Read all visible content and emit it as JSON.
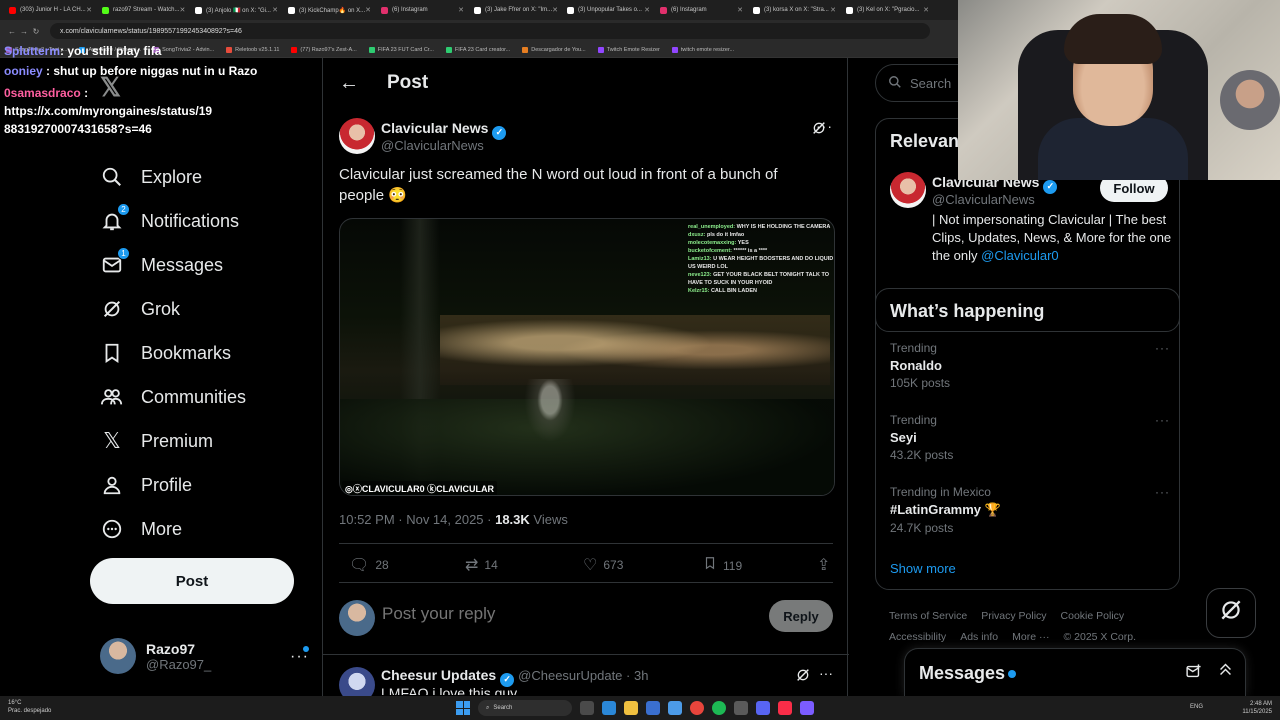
{
  "browser": {
    "tabs": [
      {
        "title": "(303) Junior H - LA CH...",
        "color": "#ff0000"
      },
      {
        "title": "razo97 Stream - Watch...",
        "color": "#53fc18"
      },
      {
        "title": "(3) Anjolo 🇮🇹 on X: \"Gi...",
        "color": "#ffffff"
      },
      {
        "title": "(3) KickChamp🔥 on X...",
        "color": "#ffffff"
      },
      {
        "title": "(6) Instagram",
        "color": "#e1306c"
      },
      {
        "title": "(3) Jake Ffrer on X: \"Im...",
        "color": "#ffffff"
      },
      {
        "title": "(3) Unpopular Takes o...",
        "color": "#ffffff"
      },
      {
        "title": "(6) Instagram",
        "color": "#e1306c"
      },
      {
        "title": "(3) korsa X on X: \"Stra...",
        "color": "#ffffff"
      },
      {
        "title": "(3) Kel on X: \"Pgracio...",
        "color": "#ffffff"
      }
    ],
    "url": "x.com/clavicularnews/status/1989557199245340892?s=46",
    "bookmarks": [
      {
        "label": "SongTrivia2 - Test y...",
        "color": "#9b59b6"
      },
      {
        "label": "App Store / Streami...",
        "color": "#1d9bf0"
      },
      {
        "label": "SongTrivia2 - Advin...",
        "color": "#9b59b6"
      },
      {
        "label": "Reletoob v25.1.11",
        "color": "#e74c3c"
      },
      {
        "label": "(77) Razo97's Zest-A...",
        "color": "#ff0000"
      },
      {
        "label": "FIFA 23 FUT Card Cr...",
        "color": "#2ecc71"
      },
      {
        "label": "FIFA 23 Card creator...",
        "color": "#2ecc71"
      },
      {
        "label": "Descargador de You...",
        "color": "#e67e22"
      },
      {
        "label": "Twitch Emote Resizer",
        "color": "#9146ff"
      },
      {
        "label": "twitch emote resizer...",
        "color": "#9146ff"
      }
    ]
  },
  "chat_overlay": {
    "top_line": "you still play fifa",
    "top_name": "Splutterm",
    "lines": [
      {
        "name": "ooniey",
        "message": ": shut up before niggas nut in u Razo"
      },
      {
        "name": "0samasdraco",
        "message": ":"
      },
      {
        "name": "",
        "message": "https://x.com/myrongaines/status/1988319270007431658?s=46"
      }
    ]
  },
  "nav": {
    "items": [
      {
        "label": "Explore"
      },
      {
        "label": "Notifications",
        "badge": "2"
      },
      {
        "label": "Messages",
        "badge": "1"
      },
      {
        "label": "Grok"
      },
      {
        "label": "Bookmarks"
      },
      {
        "label": "Communities"
      },
      {
        "label": "Premium"
      },
      {
        "label": "Profile"
      },
      {
        "label": "More"
      }
    ],
    "post_button": "Post"
  },
  "account": {
    "name": "Razo97",
    "handle": "@Razo97_"
  },
  "post": {
    "header_title": "Post",
    "author_name": "Clavicular News",
    "author_handle": "@ClavicularNews",
    "text": "Clavicular just screamed the N word out loud in front of a bunch of people 😳",
    "media_chat": [
      {
        "user": "real_unemployed:",
        "msg": "WHY IS HE HOLDING THE CAMERA"
      },
      {
        "user": "dxusz:",
        "msg": "pls do it lmfao"
      },
      {
        "user": "molecotemaxxing:",
        "msg": "YES"
      },
      {
        "user": "bucketofcement:",
        "msg": "****** is a ****"
      },
      {
        "user": "Lamiz13:",
        "msg": "U WEAR HEIGHT BOOSTERS AND DO LIQUID US WEIRD LOL"
      },
      {
        "user": "neve123:",
        "msg": "GET YOUR BLACK BELT TONIGHT TALK TO HAVE TO SUCK IN YOUR HYOID"
      },
      {
        "user": "Kelzr15:",
        "msg": "CALL BIN LADEN"
      }
    ],
    "media_watermark": "◎ⓧCLAVICULAR0 ⓚCLAVICULAR",
    "timestamp": "10:52 PM · Nov 14, 2025 · ",
    "views": "18.3K",
    "views_label": "Views",
    "replies": "28",
    "reposts": "14",
    "likes": "673",
    "bookmarks": "119",
    "reply_placeholder": "Post your reply",
    "reply_button": "Reply"
  },
  "reply_tweet": {
    "name": "Cheesur Updates",
    "handle": "@CheesurUpdate · 3h",
    "text": "LMFAO i love this guy"
  },
  "right": {
    "search_placeholder": "Search",
    "relevant_title": "Relevant people",
    "relevant_name": "Clavicular News",
    "relevant_handle": "@ClavicularNews",
    "follow_label": "Follow",
    "relevant_bio": "| Not impersonating Clavicular | The best Clips, Updates, News, & More for the one the only ",
    "relevant_bio_link": "@Clavicular0",
    "happening_title": "What’s happening",
    "trends": [
      {
        "meta": "Trending",
        "title": "Ronaldo",
        "count": "105K posts"
      },
      {
        "meta": "Trending",
        "title": "Seyi",
        "count": "43.2K posts"
      },
      {
        "meta": "Trending in Mexico",
        "title": "#LatinGrammy 🏆",
        "count": "24.7K posts"
      }
    ],
    "show_more": "Show more",
    "footer": [
      "Terms of Service",
      "Privacy Policy",
      "Cookie Policy",
      "Accessibility",
      "Ads info",
      "More ···",
      "© 2025 X Corp."
    ]
  },
  "messages_drawer": {
    "title": "Messages"
  },
  "taskbar": {
    "weather_temp": "16°C",
    "weather_desc": "Prac. despejado",
    "search": "Search",
    "lang": "ENG",
    "time": "2:48 AM",
    "date": "11/15/2025"
  },
  "colors": {
    "accent": "#1d9bf0",
    "background": "#000000",
    "text": "#e7e9ea",
    "muted": "#71767b",
    "border": "#2f3336"
  }
}
